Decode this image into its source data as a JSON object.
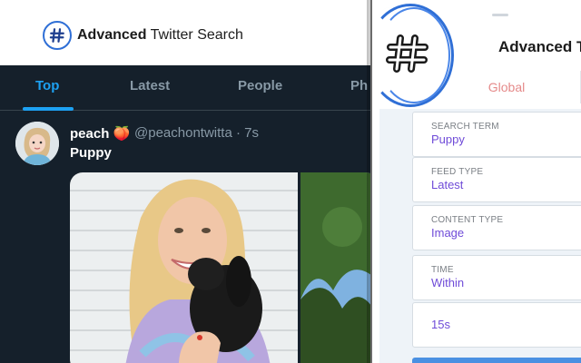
{
  "brand": {
    "bold": "Advanced",
    "rest": "Twitter Search"
  },
  "feed": {
    "tabs": [
      {
        "label": "Top",
        "active": true
      },
      {
        "label": "Latest",
        "active": false
      },
      {
        "label": "People",
        "active": false
      },
      {
        "label": "Ph",
        "active": false
      }
    ],
    "tweet": {
      "name": "peach 🍑",
      "handle": "@peachontwitta · 7s",
      "text": "Puppy"
    }
  },
  "panel": {
    "title": "Advanced Tw",
    "scope_tab": "Global",
    "fields": {
      "search_term": {
        "label": "SEARCH TERM",
        "value": "Puppy"
      },
      "feed_type": {
        "label": "FEED TYPE",
        "value": "Latest"
      },
      "content_type": {
        "label": "CONTENT TYPE",
        "value": "Image"
      },
      "time": {
        "label": "TIME",
        "value": "Within"
      },
      "duration": {
        "value": "15s"
      }
    }
  },
  "colors": {
    "feed_bg": "#15202b",
    "accent_blue": "#1da1f2",
    "brand_blue": "#2f6fd6",
    "field_value": "#6f4bd8",
    "scope_tab": "#e58a8a"
  },
  "icons": {
    "logo": "hashtag-icon",
    "badge": "hashtag-icon"
  }
}
